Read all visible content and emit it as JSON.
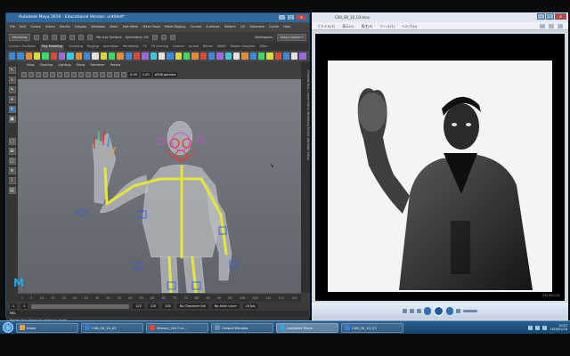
{
  "maya": {
    "title": "Autodesk Maya 2016 - Educational Version: untitled*",
    "menus": [
      "File",
      "Edit",
      "Create",
      "Select",
      "Modify",
      "Display",
      "Windows",
      "Mesh",
      "Edit Mesh",
      "Mesh Tools",
      "Mesh Display",
      "Curves",
      "Surfaces",
      "Deform",
      "UV",
      "Generate",
      "Cache",
      "Help"
    ],
    "mode": "Modeling",
    "no_live_surface": "No Live Surface",
    "symmetry": "Symmetry: Off",
    "workspace_label": "Workspace:",
    "workspace": "Maya Classic*",
    "shelf_tabs": [
      "Curves / Surfaces",
      "Poly Modeling",
      "Sculpting",
      "Rigging",
      "Animation",
      "Rendering",
      "FX",
      "FX Caching",
      "Custom",
      "Arnold",
      "Bifrost",
      "MASH",
      "Motion Graphics",
      "XGen"
    ],
    "active_shelf": "Poly Modeling",
    "panel_menus": [
      "View",
      "Shading",
      "Lighting",
      "Show",
      "Renderer",
      "Panels"
    ],
    "panel_values": [
      "0.00",
      "1.00"
    ],
    "color_space": "sRGB gamma",
    "right_tabs": "Channel Box / Layer Editor   Modelling Toolkit   Attribute Editor",
    "time_ticks": [
      "1",
      "5",
      "10",
      "15",
      "20",
      "25",
      "30",
      "35",
      "40",
      "45",
      "50",
      "55",
      "60",
      "65",
      "70",
      "75",
      "80",
      "85",
      "90",
      "95",
      "100",
      "105",
      "110",
      "115",
      "120"
    ],
    "range_start": "1",
    "range_inner_start": "1",
    "range_inner_end": "120",
    "range_end": "120",
    "range_max": "200",
    "character_set": "No Character Set",
    "anim_layer": "No Anim Layer",
    "fps": "24 fps",
    "cmd_label": "MEL",
    "help_line": "Rotate Tool: Select an object to rotate."
  },
  "player": {
    "title": "C08_09_10_03.mov",
    "menus": [
      "ファイル(F)",
      "表示(V)",
      "再生(P)",
      "ツール(T)",
      "ヘルプ(H)"
    ],
    "caption": "C08_09_10.C0010_com",
    "timestamp": "2016/01/18"
  },
  "taskbar": {
    "tasks": [
      {
        "label": "Inbox",
        "color": "#e7a33a"
      },
      {
        "label": "C08_09_10_02",
        "color": "#3a7bd5"
      },
      {
        "label": "Winscp_2017.m...",
        "color": "#d44b3a"
      },
      {
        "label": "Output Window",
        "color": "#6c8eb3"
      },
      {
        "label": "Autodesk Maya",
        "color": "#2aa8e0"
      },
      {
        "label": "C08_09_10_03",
        "color": "#3a7bd5"
      }
    ],
    "time": "10:57",
    "date": "2016/01/18"
  },
  "colors": {
    "maya_accent": "#27a9e1",
    "rig_yellow": "#e6e63a",
    "rig_red": "#e0403a",
    "titlebar": "#2e6aa0"
  }
}
